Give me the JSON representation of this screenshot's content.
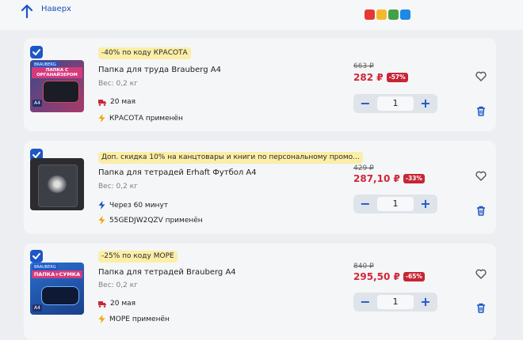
{
  "header": {
    "back_label": "Наверх"
  },
  "brand": {
    "logo_colors": [
      "#e53935",
      "#f5b82e",
      "#43a047",
      "#1e88e5"
    ]
  },
  "colors": {
    "accent": "#1d57c8",
    "price": "#d2273a",
    "promo_bg": "#fbeea7"
  },
  "items": [
    {
      "promo": "-40% по коду КРАСОТА",
      "title": "Папка для труда Brauberg A4",
      "weight": "Вес: 0,2 кг",
      "delivery_icon": "truck-icon",
      "delivery": "20 мая",
      "code_note": "КРАСОТА применён",
      "old_price": "663 ₽",
      "price": "282 ₽",
      "discount": "-57%",
      "quantity": "1",
      "thumb_text": "ПАПКА С ОРГАНАЙЗЕРОМ",
      "thumb_brand": "BRAUBERG",
      "thumb_size": "A4"
    },
    {
      "promo": "Доп. скидка 10% на канцтовары и книги по персональному промо...",
      "title": "Папка для тетрадей Erhaft Футбол А4",
      "weight": "Вес: 0,2 кг",
      "delivery_icon": "lightning-icon",
      "delivery": "Через 60 минут",
      "code_note": "55GEDJW2QZV применён",
      "old_price": "429 ₽",
      "price": "287,10 ₽",
      "discount": "-33%",
      "quantity": "1"
    },
    {
      "promo": "-25% по коду МОРЕ",
      "title": "Папка для тетрадей Brauberg A4",
      "weight": "Вес: 0,2 кг",
      "delivery_icon": "truck-icon",
      "delivery": "20 мая",
      "code_note": "МОРЕ применён",
      "old_price": "840 ₽",
      "price": "295,50 ₽",
      "discount": "-65%",
      "quantity": "1",
      "thumb_text": "ПАПКА+СУМКА",
      "thumb_brand": "BRAUBERG",
      "thumb_size": "A4"
    }
  ]
}
